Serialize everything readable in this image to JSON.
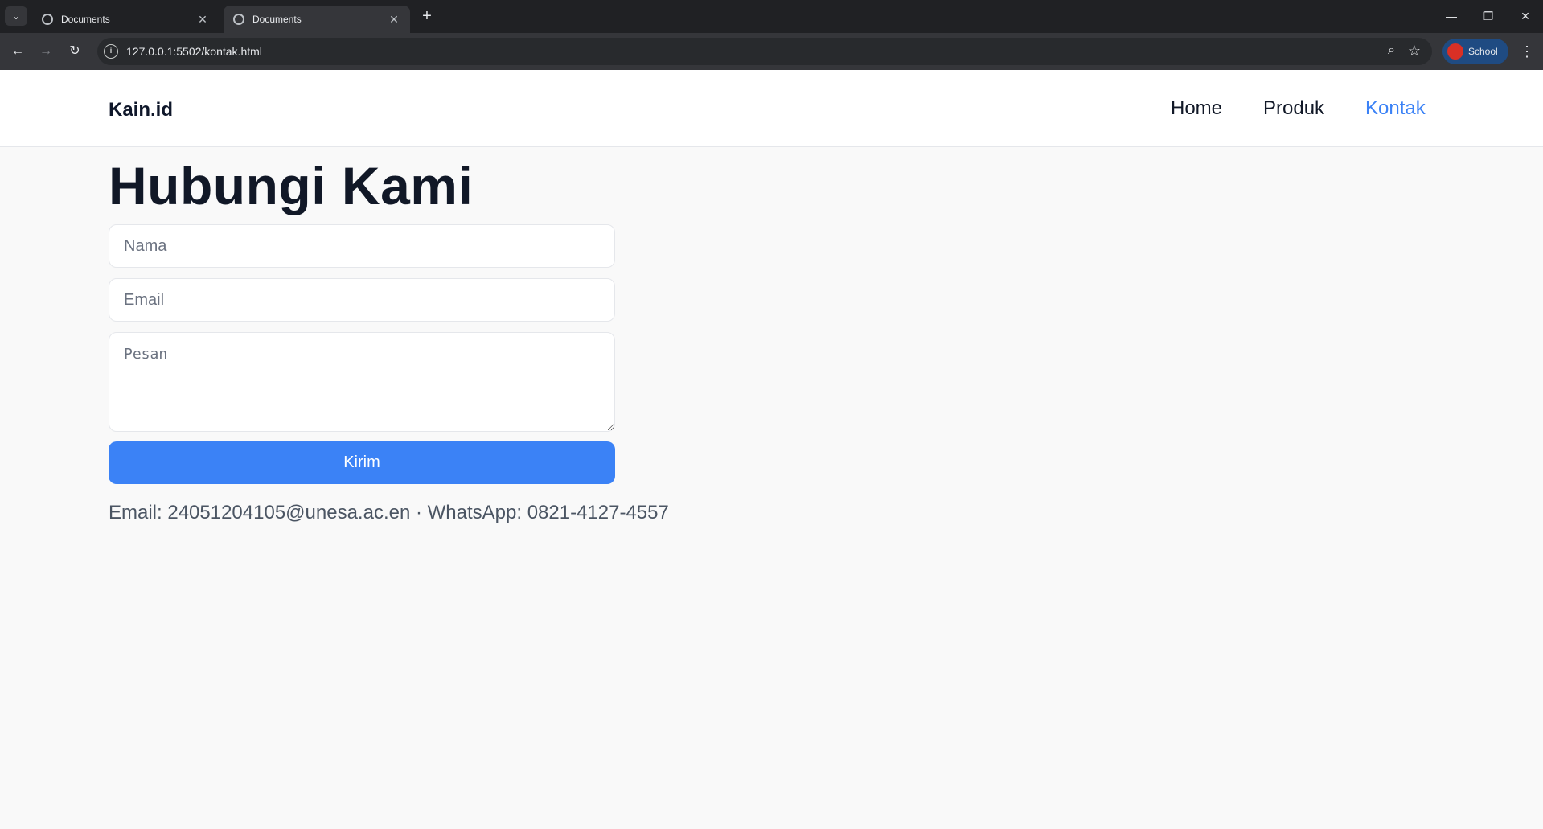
{
  "browser": {
    "tabs": [
      {
        "title": "Documents",
        "active": false
      },
      {
        "title": "Documents",
        "active": true
      }
    ],
    "url": "127.0.0.1:5502/kontak.html",
    "profile_label": "School"
  },
  "site": {
    "logo": "Kain.id",
    "nav": [
      {
        "label": "Home",
        "active": false
      },
      {
        "label": "Produk",
        "active": false
      },
      {
        "label": "Kontak",
        "active": true
      }
    ]
  },
  "contact": {
    "heading": "Hubungi Kami",
    "name_placeholder": "Nama",
    "email_placeholder": "Email",
    "message_placeholder": "Pesan",
    "submit_label": "Kirim",
    "info": "Email: 24051204105@unesa.ac.en · WhatsApp: 0821-4127-4557"
  },
  "colors": {
    "accent": "#3b82f6",
    "heading": "#111827",
    "muted_text": "#4b5563"
  }
}
